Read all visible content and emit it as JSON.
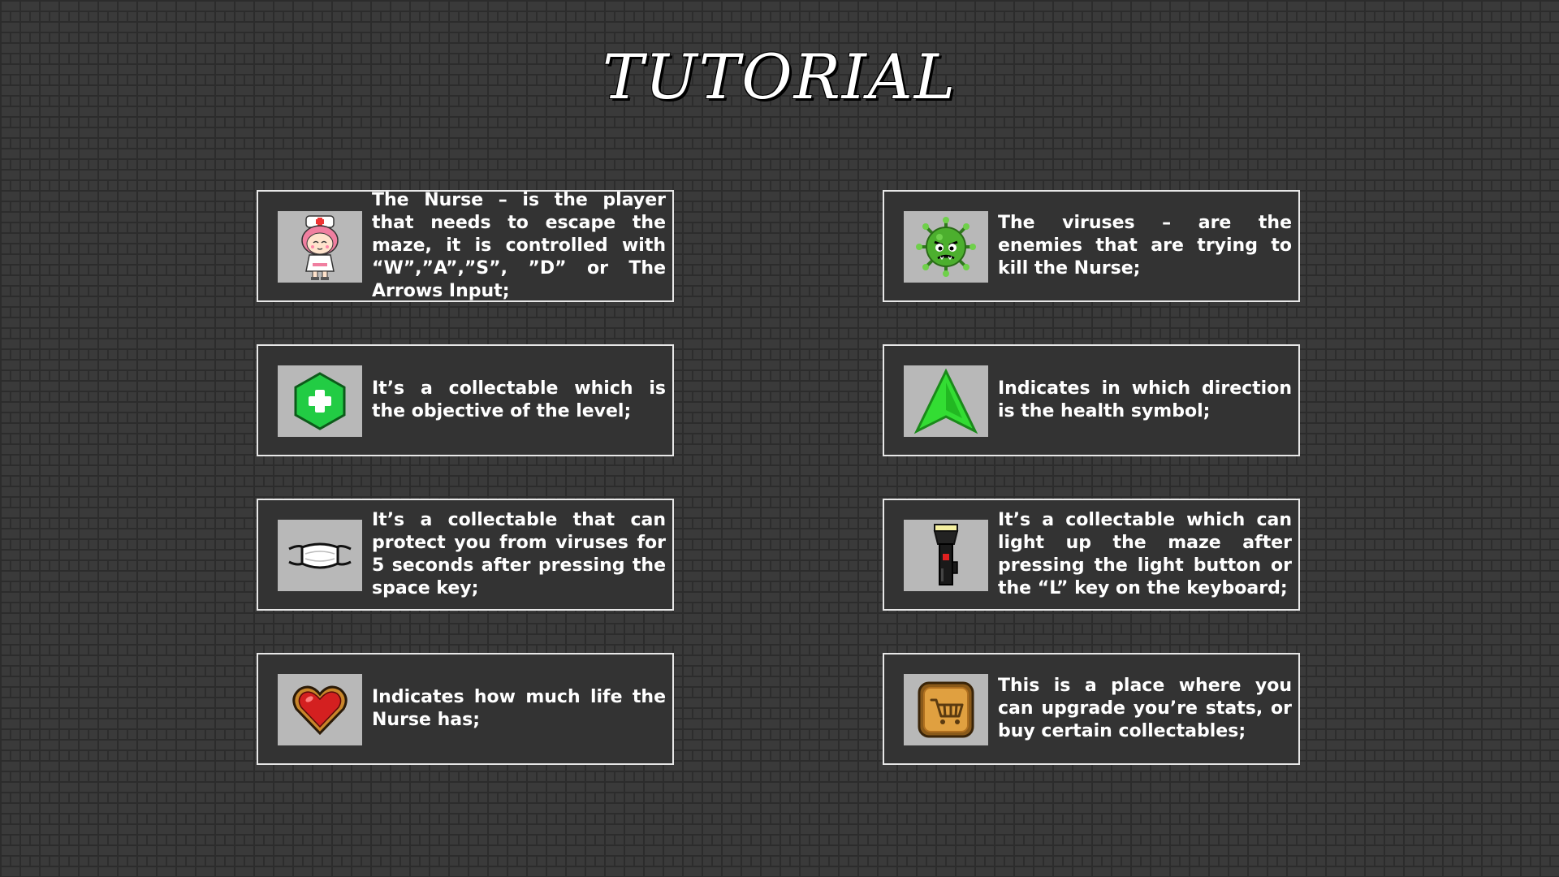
{
  "title": "TUTORIAL",
  "cards": [
    {
      "icon": "nurse-icon",
      "text": "The Nurse – is the player that needs to escape the maze, it is controlled with “W”,”A”,”S”, ”D” or The Arrows Input;"
    },
    {
      "icon": "virus-icon",
      "text": "The viruses – are the enemies that are trying to kill the Nurse;"
    },
    {
      "icon": "health-cross-icon",
      "text": "It’s a collectable which is the objective of the level;"
    },
    {
      "icon": "direction-arrow-icon",
      "text": "Indicates in which direction is the health symbol;"
    },
    {
      "icon": "mask-icon",
      "text": "It’s a collectable that can protect you from viruses for 5 seconds after pressing the space key;"
    },
    {
      "icon": "flashlight-icon",
      "text": "It’s a collectable which can light up the maze after pressing the light button or the “L” key on the keyboard;"
    },
    {
      "icon": "heart-icon",
      "text": "Indicates how much life the Nurse has;"
    },
    {
      "icon": "shop-cart-icon",
      "text": "This is a place where you can upgrade you’re stats, or buy certain collectables;"
    }
  ],
  "colors": {
    "background": "#3a3a3a",
    "card": "#333333",
    "card_border": "#e8e8e8",
    "icon_bg": "#b8b8b8",
    "health_green": "#22cc44",
    "arrow_green": "#33dd33",
    "heart_red": "#d42020",
    "shop_gold": "#d9963a"
  }
}
